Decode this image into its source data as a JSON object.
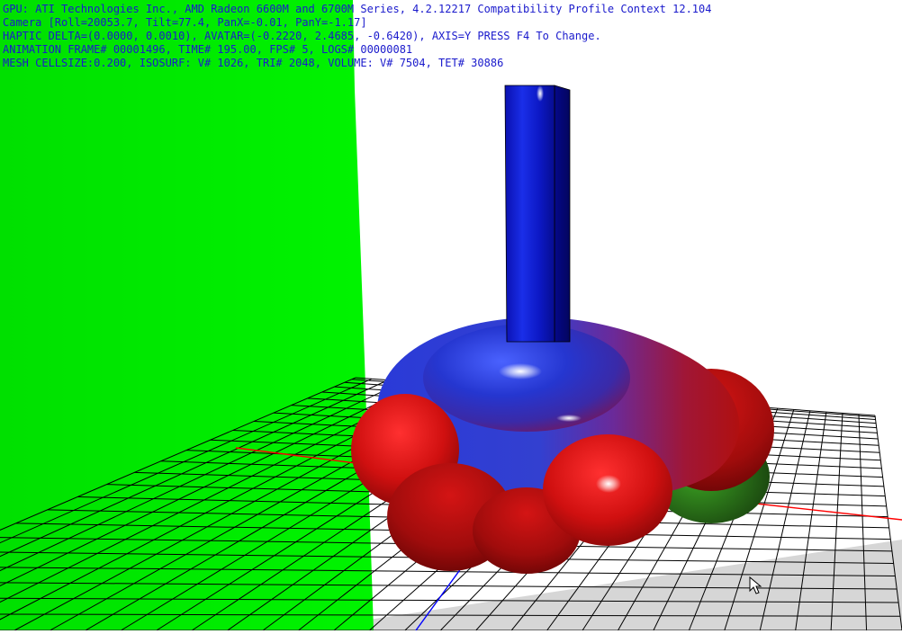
{
  "colors": {
    "hud_text": "#1a1acc",
    "background": "#ffffff",
    "wall": "#00ee00",
    "grid_line": "#000000",
    "axis_x": "#ff0000",
    "axis_z": "#0000ff",
    "tool_shaft": "#0a14c8",
    "blob_top": "#2233cc",
    "blob_side": "#cc1010",
    "blob_shadow": "#2a8a1a"
  },
  "hud": {
    "lines": [
      "GPU: ATI Technologies Inc., AMD Radeon 6600M and 6700M Series, 4.2.12217 Compatibility Profile Context 12.104",
      "Camera [Roll=20053.7, Tilt=77.4, PanX=-0.01, PanY=-1.17]",
      "HAPTIC DELTA=(0.0000, 0.0010), AVATAR=(-0.2220, 2.4685, -0.6420), AXIS=Y PRESS F4 To Change.",
      "ANIMATION FRAME# 00001496, TIME# 195.00, FPS# 5, LOGS# 00000081",
      "MESH CELLSIZE:0.200, ISOSURF: V# 1026, TRI# 2048, VOLUME: V# 7504, TET# 30886"
    ]
  },
  "scene": {
    "objects": [
      "green-wall-plane",
      "floor-grid",
      "red-x-axis",
      "blue-z-axis",
      "blue-haptic-tool",
      "isosurface-mesh",
      "mouse-cursor-icon"
    ]
  }
}
